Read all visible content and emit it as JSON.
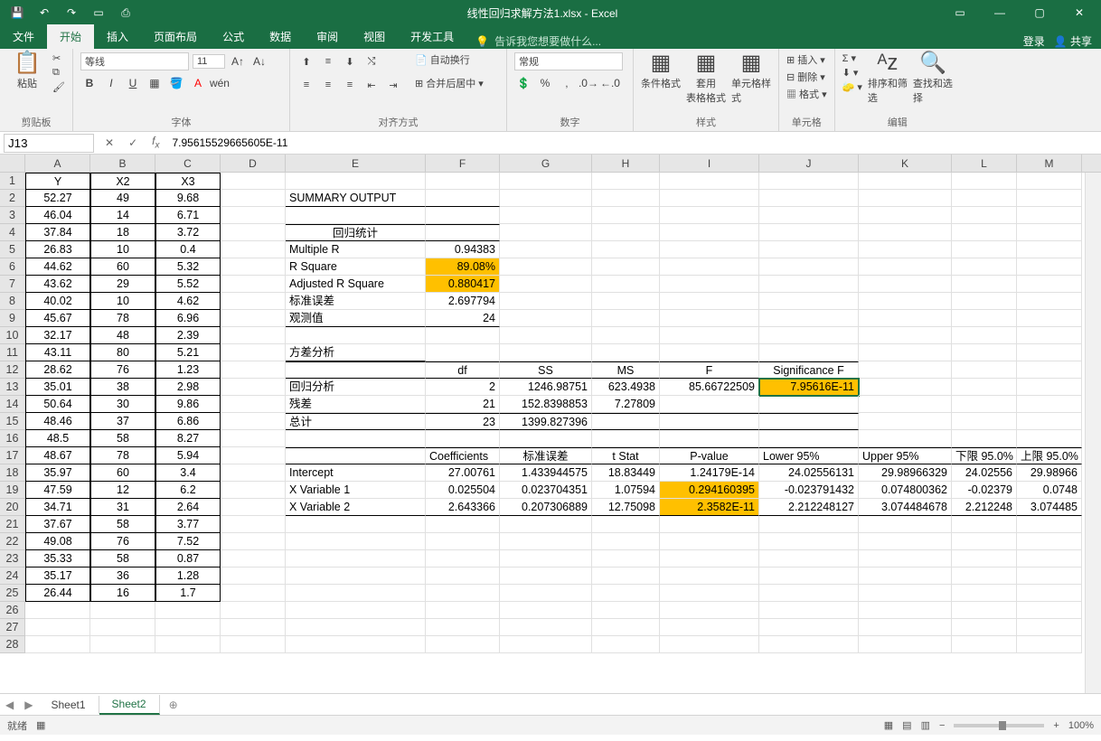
{
  "title": "线性回归求解方法1.xlsx - Excel",
  "tabs": {
    "file": "文件",
    "home": "开始",
    "insert": "插入",
    "layout": "页面布局",
    "formulas": "公式",
    "data": "数据",
    "review": "审阅",
    "view": "视图",
    "dev": "开发工具",
    "tellme": "告诉我您想要做什么...",
    "login": "登录",
    "share": "共享"
  },
  "ribbon": {
    "clipboard": {
      "paste": "粘贴",
      "label": "剪贴板"
    },
    "font": {
      "name": "等线",
      "size": "11",
      "label": "字体"
    },
    "align": {
      "wrap": "自动换行",
      "merge": "合并后居中",
      "label": "对齐方式"
    },
    "number": {
      "format": "常规",
      "label": "数字"
    },
    "styles": {
      "cond": "条件格式",
      "table": "套用\n表格格式",
      "cell": "单元格样式",
      "label": "样式"
    },
    "cells": {
      "insert": "插入",
      "delete": "删除",
      "format": "格式",
      "label": "单元格"
    },
    "editing": {
      "sort": "排序和筛选",
      "find": "查找和选择",
      "label": "编辑"
    }
  },
  "namebox": "J13",
  "formula": "7.95615529665605E-11",
  "headers": [
    "A",
    "B",
    "C",
    "D",
    "E",
    "F",
    "G",
    "H",
    "I",
    "J",
    "K",
    "L",
    "M"
  ],
  "grid": {
    "r1": {
      "A": "Y",
      "B": "X2",
      "C": "X3"
    },
    "r2": {
      "A": "52.27",
      "B": "49",
      "C": "9.68",
      "E": "SUMMARY OUTPUT"
    },
    "r3": {
      "A": "46.04",
      "B": "14",
      "C": "6.71"
    },
    "r4": {
      "A": "37.84",
      "B": "18",
      "C": "3.72",
      "E": "回归统计"
    },
    "r5": {
      "A": "26.83",
      "B": "10",
      "C": "0.4",
      "E": "Multiple R",
      "F": "0.94383"
    },
    "r6": {
      "A": "44.62",
      "B": "60",
      "C": "5.32",
      "E": "R Square",
      "F": "89.08%"
    },
    "r7": {
      "A": "43.62",
      "B": "29",
      "C": "5.52",
      "E": "Adjusted R Square",
      "F": "0.880417"
    },
    "r8": {
      "A": "40.02",
      "B": "10",
      "C": "4.62",
      "E": "标准误差",
      "F": "2.697794"
    },
    "r9": {
      "A": "45.67",
      "B": "78",
      "C": "6.96",
      "E": "观测值",
      "F": "24"
    },
    "r10": {
      "A": "32.17",
      "B": "48",
      "C": "2.39"
    },
    "r11": {
      "A": "43.11",
      "B": "80",
      "C": "5.21",
      "E": "方差分析"
    },
    "r12": {
      "A": "28.62",
      "B": "76",
      "C": "1.23",
      "F": "df",
      "G": "SS",
      "H": "MS",
      "I": "F",
      "J": "Significance F"
    },
    "r13": {
      "A": "35.01",
      "B": "38",
      "C": "2.98",
      "E": "回归分析",
      "F": "2",
      "G": "1246.98751",
      "H": "623.4938",
      "I": "85.66722509",
      "J": "7.95616E-11"
    },
    "r14": {
      "A": "50.64",
      "B": "30",
      "C": "9.86",
      "E": "残差",
      "F": "21",
      "G": "152.8398853",
      "H": "7.27809"
    },
    "r15": {
      "A": "48.46",
      "B": "37",
      "C": "6.86",
      "E": "总计",
      "F": "23",
      "G": "1399.827396"
    },
    "r16": {
      "A": "48.5",
      "B": "58",
      "C": "8.27"
    },
    "r17": {
      "A": "48.67",
      "B": "78",
      "C": "5.94",
      "F": "Coefficients",
      "G": "标准误差",
      "H": "t Stat",
      "I": "P-value",
      "J": "Lower 95%",
      "K": "Upper 95%",
      "L": "下限 95.0%",
      "M": "上限 95.0%"
    },
    "r18": {
      "A": "35.97",
      "B": "60",
      "C": "3.4",
      "E": "Intercept",
      "F": "27.00761",
      "G": "1.433944575",
      "H": "18.83449",
      "I": "1.24179E-14",
      "J": "24.02556131",
      "K": "29.98966329",
      "L": "24.02556",
      "M": "29.98966"
    },
    "r19": {
      "A": "47.59",
      "B": "12",
      "C": "6.2",
      "E": "X Variable 1",
      "F": "0.025504",
      "G": "0.023704351",
      "H": "1.07594",
      "I": "0.294160395",
      "J": "-0.023791432",
      "K": "0.074800362",
      "L": "-0.02379",
      "M": "0.0748"
    },
    "r20": {
      "A": "34.71",
      "B": "31",
      "C": "2.64",
      "E": "X Variable 2",
      "F": "2.643366",
      "G": "0.207306889",
      "H": "12.75098",
      "I": "2.3582E-11",
      "J": "2.212248127",
      "K": "3.074484678",
      "L": "2.212248",
      "M": "3.074485"
    },
    "r21": {
      "A": "37.67",
      "B": "58",
      "C": "3.77"
    },
    "r22": {
      "A": "49.08",
      "B": "76",
      "C": "7.52"
    },
    "r23": {
      "A": "35.33",
      "B": "58",
      "C": "0.87"
    },
    "r24": {
      "A": "35.17",
      "B": "36",
      "C": "1.28"
    },
    "r25": {
      "A": "26.44",
      "B": "16",
      "C": "1.7"
    }
  },
  "sheets": {
    "s1": "Sheet1",
    "s2": "Sheet2"
  },
  "status": {
    "ready": "就绪",
    "zoom": "100%"
  }
}
